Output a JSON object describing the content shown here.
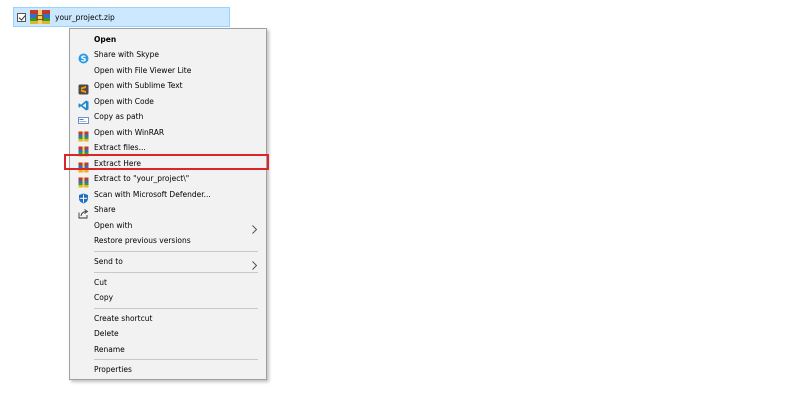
{
  "file": {
    "name": "your_project.zip"
  },
  "menu": {
    "items": [
      {
        "label": "Open",
        "icon": "none",
        "bold": true
      },
      {
        "label": "Share with Skype",
        "icon": "skype-icon"
      },
      {
        "label": "Open with File Viewer Lite",
        "icon": "none"
      },
      {
        "label": "Open with Sublime Text",
        "icon": "sublime-icon"
      },
      {
        "label": "Open with Code",
        "icon": "vscode-icon"
      },
      {
        "label": "Copy as path",
        "icon": "copy-path-icon"
      },
      {
        "label": "Open with WinRAR",
        "icon": "winrar-icon"
      },
      {
        "label": "Extract files...",
        "icon": "winrar-icon"
      },
      {
        "label": "Extract Here",
        "icon": "winrar-icon"
      },
      {
        "label": "Extract to \"your_project\\\"",
        "icon": "winrar-icon"
      },
      {
        "label": "Scan with Microsoft Defender...",
        "icon": "defender-icon"
      },
      {
        "label": "Share",
        "icon": "share-icon"
      },
      {
        "label": "Open with",
        "icon": "none",
        "submenu": true
      },
      {
        "label": "Restore previous versions",
        "icon": "none"
      },
      {
        "label": "Send to",
        "icon": "none",
        "submenu": true
      },
      {
        "label": "Cut",
        "icon": "none"
      },
      {
        "label": "Copy",
        "icon": "none"
      },
      {
        "label": "Create shortcut",
        "icon": "none"
      },
      {
        "label": "Delete",
        "icon": "none"
      },
      {
        "label": "Rename",
        "icon": "none"
      },
      {
        "label": "Properties",
        "icon": "none"
      }
    ]
  },
  "highlight": {
    "target": "Extract Here",
    "color": "#d9262b"
  },
  "colors": {
    "selection": "#cce8ff",
    "menu_bg": "#f2f2f2"
  }
}
